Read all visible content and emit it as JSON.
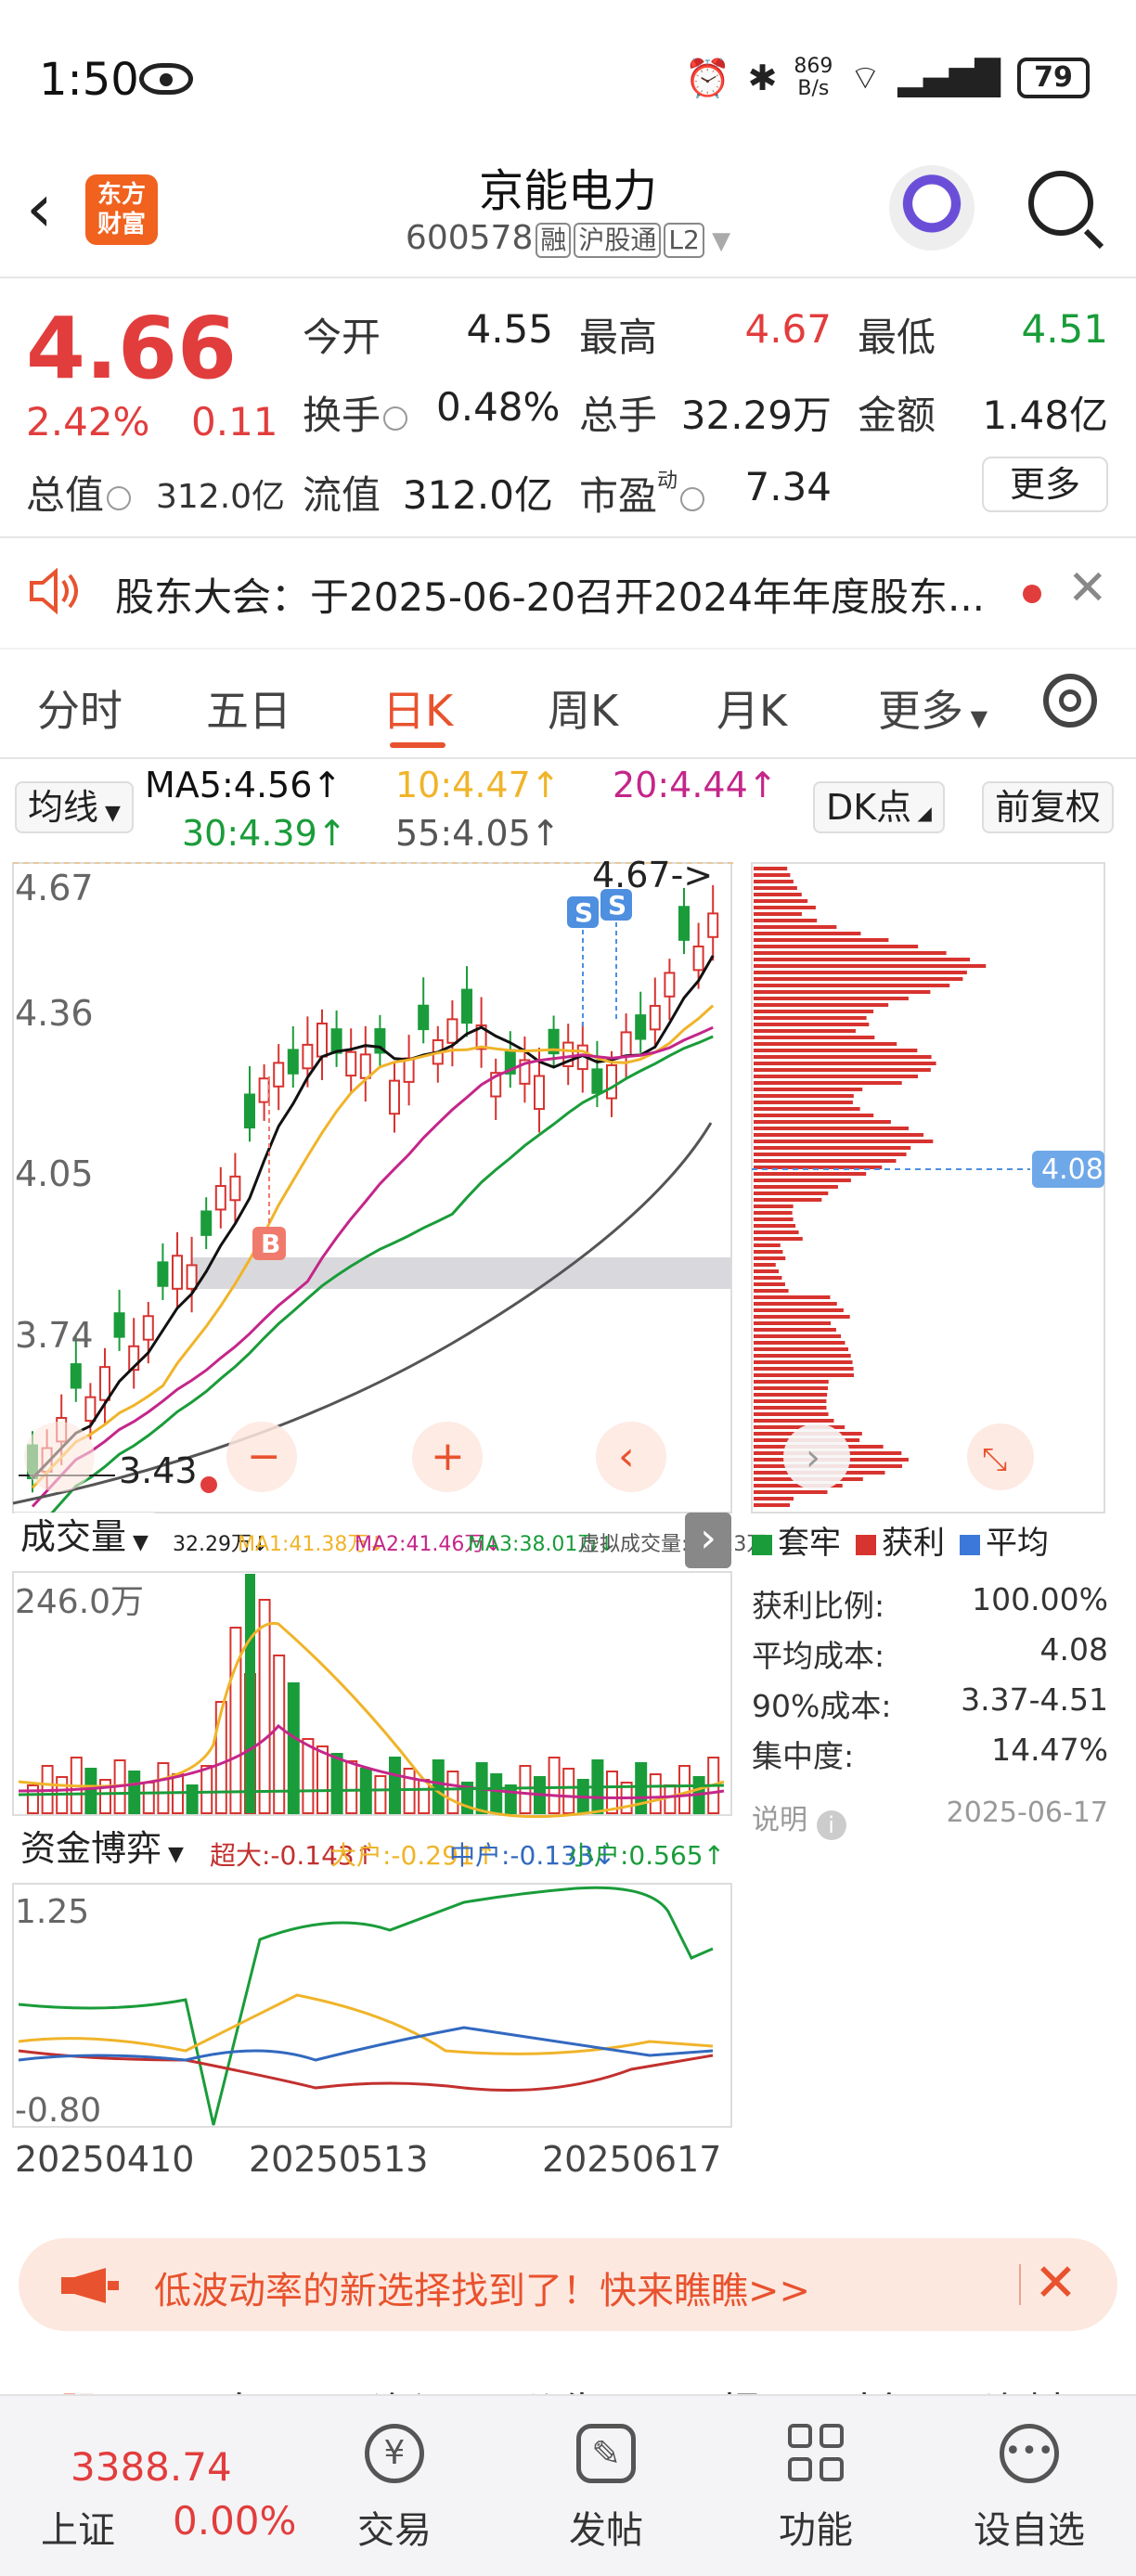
{
  "status_bar": {
    "time": "1:50",
    "net_speed_value": "869",
    "net_speed_unit": "B/s",
    "battery": "79"
  },
  "header": {
    "title": "京能电力",
    "code": "600578",
    "tags": [
      "融",
      "沪股通",
      "L2"
    ]
  },
  "quote": {
    "price": "4.66",
    "change_pct": "2.42%",
    "change": "0.11",
    "total_value_label": "总值",
    "total_value": "312.0亿",
    "fields": {
      "open_label": "今开",
      "open": "4.55",
      "high_label": "最高",
      "high": "4.67",
      "low_label": "最低",
      "low": "4.51",
      "turnover_label": "换手",
      "turnover": "0.48%",
      "volume_label": "总手",
      "volume": "32.29万",
      "amount_label": "金额",
      "amount": "1.48亿",
      "float_label": "流值",
      "float": "312.0亿",
      "pe_label": "市盈",
      "pe_sup": "动",
      "pe": "7.34"
    },
    "more_label": "更多"
  },
  "notice": {
    "text": "股东大会：于2025-06-20召开2024年年度股东..."
  },
  "tabs": [
    "分时",
    "五日",
    "日K",
    "周K",
    "月K",
    "更多"
  ],
  "active_tab": "日K",
  "ma_legend": {
    "selector": "均线",
    "ma5": "MA5:4.56↑",
    "ma10": "10:4.47↑",
    "ma20": "20:4.44↑",
    "ma30": "30:4.39↑",
    "ma55": "55:4.05↑",
    "dk_button": "DK点",
    "adjust_button": "前复权"
  },
  "kline": {
    "y_labels": [
      "4.67",
      "4.36",
      "4.05",
      "3.74"
    ],
    "high_marker": "4.67->",
    "low_marker": "3.43",
    "chip_avg_label": "4.08",
    "colors": {
      "up": "#d7332f",
      "down": "#1a9c3a",
      "ma5": "#111111",
      "ma10": "#f0b429",
      "ma20": "#c4268a",
      "ma30": "#1a9c3a",
      "ma55": "#555555"
    }
  },
  "volume_panel": {
    "selector": "成交量",
    "legend": [
      "32.29万↓",
      "MA1:41.38万↓",
      "MA2:41.46万↓",
      "MA3:38.01万↓",
      "虚拟成交量:40.23万"
    ],
    "max_label": "246.0万"
  },
  "fund_panel": {
    "selector": "资金博弈",
    "legend": [
      "超大:-0.143↑",
      "大户:-0.291↑",
      "中户:-0.133↓",
      "小户:0.565↑"
    ],
    "y_top": "1.25",
    "y_bottom": "-0.80",
    "x_labels": [
      "20250410",
      "20250513",
      "20250617"
    ]
  },
  "chip_panel": {
    "legend": [
      "套牢",
      "获利",
      "平均"
    ],
    "rows": [
      {
        "label": "获利比例:",
        "value": "100.00%"
      },
      {
        "label": "平均成本:",
        "value": "4.08"
      },
      {
        "label": "90%成本:",
        "value": "3.37-4.51"
      },
      {
        "label": "集中度:",
        "value": "14.47%"
      }
    ],
    "note_label": "说明",
    "date": "2025-06-17"
  },
  "banner": {
    "text": "低波动率的新选择找到了！快来瞧瞧>>"
  },
  "footer_tabs": [
    "股吧",
    "自Ｇ",
    "资讯",
    "公告",
    "研报",
    "财务",
    "资料"
  ],
  "bottom_nav": {
    "index_value": "3388.74",
    "index_name": "上证",
    "index_change": "0.00%",
    "items": [
      "交易",
      "发帖",
      "功能",
      "设自选"
    ]
  }
}
